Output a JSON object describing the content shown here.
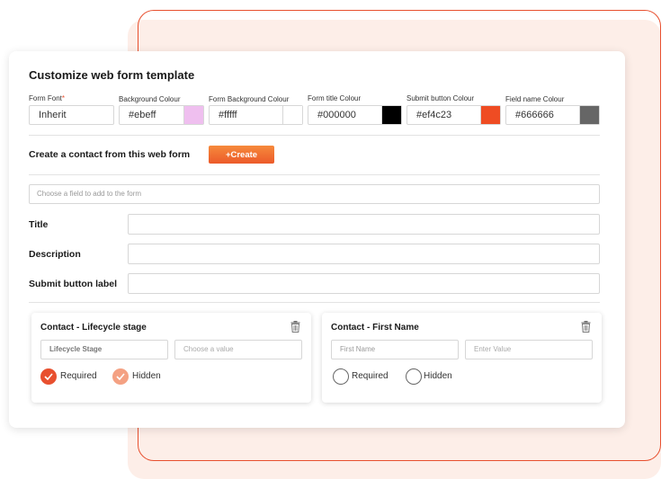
{
  "form": {
    "title": "Customize web form template",
    "fields": [
      {
        "label": "Form Font",
        "required_mark": "*",
        "value": "Inherit",
        "swatch": null
      },
      {
        "label": "Background Colour",
        "value": "#ebeff",
        "swatch": "#efbfef"
      },
      {
        "label": "Form Background Colour",
        "value": "#fffff",
        "swatch": "#ffffff"
      },
      {
        "label": "Form title Colour",
        "value": "#000000",
        "swatch": "#000000"
      },
      {
        "label": "Submit button Colour",
        "value": "#ef4c23",
        "swatch": "#ef4c23"
      },
      {
        "label": "Field name Colour",
        "value": "#666666",
        "swatch": "#666666"
      }
    ],
    "contact_label": "Create a contact from this web form",
    "create_button": "+Create",
    "choose_field_placeholder": "Choose a field to add to the form",
    "rows": [
      {
        "label": "Title"
      },
      {
        "label": "Description"
      },
      {
        "label": "Submit button label"
      }
    ]
  },
  "cards": [
    {
      "title": "Contact - Lifecycle stage",
      "field_value": "Lifecycle Stage",
      "value_placeholder": "Choose a value",
      "required_label": "Required",
      "hidden_label": "Hidden",
      "required_checked": true,
      "hidden_checked": true
    },
    {
      "title": "Contact - First Name",
      "field_value": "First Name",
      "value_placeholder": "Enter Value",
      "required_label": "Required",
      "hidden_label": "Hidden",
      "required_checked": false,
      "hidden_checked": false
    }
  ],
  "colors": {
    "accent": "#e8502f",
    "accent_light": "#f4a183",
    "bg_pink": "#fdeee8"
  }
}
